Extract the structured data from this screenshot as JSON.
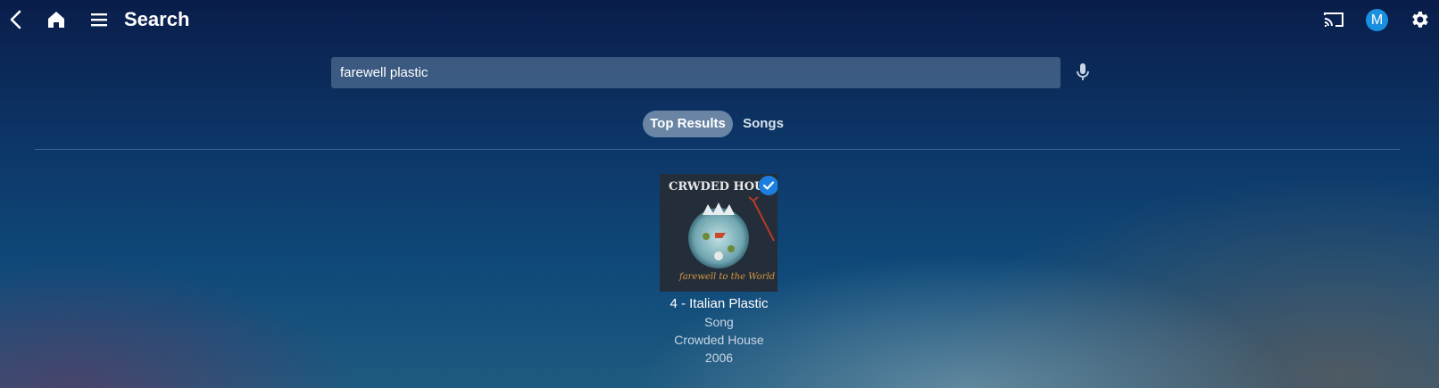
{
  "header": {
    "title": "Search",
    "back_icon": "chevron-left-icon",
    "home_icon": "home-icon",
    "menu_icon": "hamburger-menu-icon",
    "cast_icon": "cast-icon",
    "avatar_letter": "M",
    "avatar_color": "#1a8fe0",
    "settings_icon": "gear-icon"
  },
  "search": {
    "value": "farewell plastic",
    "placeholder": "",
    "mic_icon": "microphone-icon"
  },
  "tabs": [
    {
      "label": "Top Results",
      "active": true
    },
    {
      "label": "Songs",
      "active": false
    }
  ],
  "results": [
    {
      "title": "4 - Italian Plastic",
      "type": "Song",
      "artist": "Crowded House",
      "year": "2006",
      "art_text": "CRWDED HOUSE",
      "art_caption": "farewell to the World",
      "selected": true
    }
  ],
  "colors": {
    "accent": "#1c7fe0"
  }
}
